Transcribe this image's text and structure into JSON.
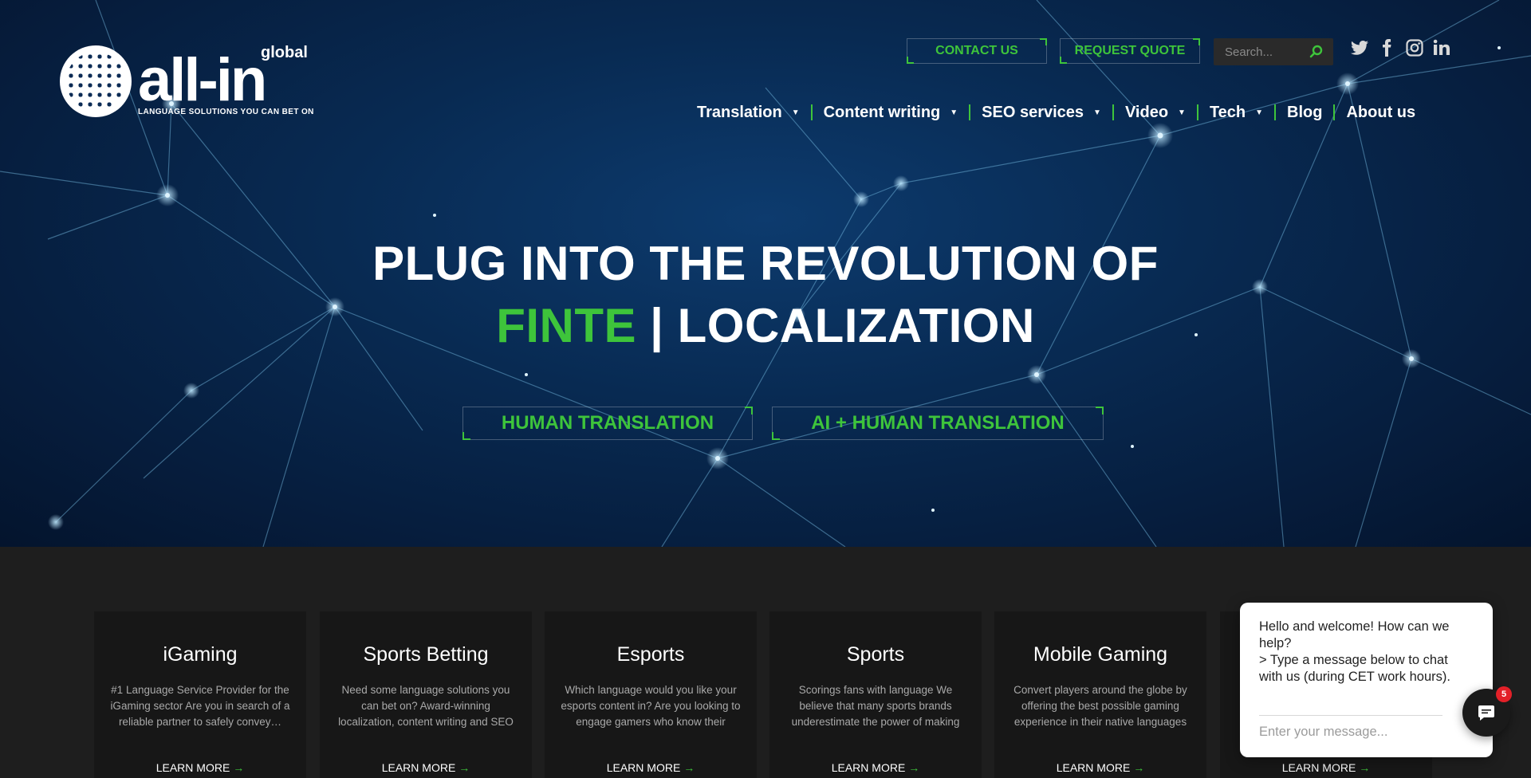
{
  "colors": {
    "accent": "#3ec43b",
    "hero_bg": "#082a52",
    "section_bg": "#1e1e1e",
    "card_bg": "#171717",
    "badge": "#e32028"
  },
  "logo": {
    "word": "all-in",
    "suffix": "global",
    "tagline": "LANGUAGE SOLUTIONS YOU CAN BET ON"
  },
  "header": {
    "contact_label": "CONTACT US",
    "quote_label": "REQUEST QUOTE",
    "search_placeholder": "Search...",
    "social": [
      "twitter-icon",
      "facebook-icon",
      "instagram-icon",
      "linkedin-icon"
    ]
  },
  "nav": {
    "items": [
      {
        "label": "Translation",
        "dropdown": true
      },
      {
        "label": "Content writing",
        "dropdown": true
      },
      {
        "label": "SEO services",
        "dropdown": true
      },
      {
        "label": "Video",
        "dropdown": true
      },
      {
        "label": "Tech",
        "dropdown": true
      },
      {
        "label": "Blog",
        "dropdown": false
      },
      {
        "label": "About us",
        "dropdown": false
      }
    ]
  },
  "hero": {
    "line1": "PLUG INTO THE REVOLUTION OF",
    "highlight": "FINTE",
    "cursor": " | ",
    "line2_rest": "LOCALIZATION",
    "cta_human": "HUMAN TRANSLATION",
    "cta_ai": "AI + HUMAN TRANSLATION"
  },
  "cards": [
    {
      "title": "iGaming",
      "text": "#1 Language Service Provider for the iGaming sector   Are you in search of a reliable partner to safely convey…",
      "link": "LEARN MORE"
    },
    {
      "title": "Sports Betting",
      "text": "Need some language solutions you can bet on?   Award-winning localization, content writing and SEO",
      "link": "LEARN MORE"
    },
    {
      "title": "Esports",
      "text": "Which language would you like your esports content in?   Are you looking to engage gamers who know their",
      "link": "LEARN MORE"
    },
    {
      "title": "Sports",
      "text": "Scorings fans with language   We believe that many sports brands underestimate the power of making",
      "link": "LEARN MORE"
    },
    {
      "title": "Mobile Gaming",
      "text": "Convert players around the globe by offering the best possible gaming experience in their native languages",
      "link": "LEARN MORE"
    },
    {
      "title": "",
      "text": "",
      "link": "LEARN MORE"
    }
  ],
  "chat": {
    "welcome": "Hello and welcome! How can we help?",
    "instruction": "> Type a message below to chat with us (during CET work hours).",
    "placeholder": "Enter your message...",
    "badge_count": "5"
  }
}
